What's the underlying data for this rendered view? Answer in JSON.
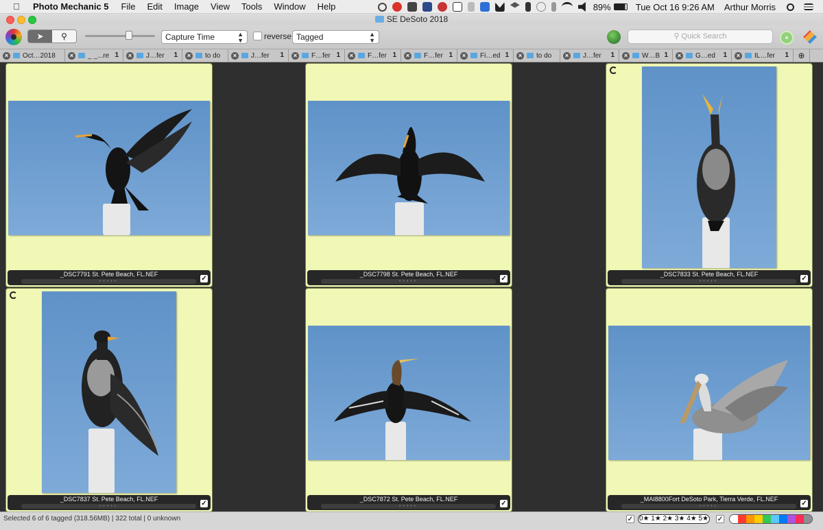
{
  "menubar": {
    "app_name": "Photo Mechanic 5",
    "menus": [
      "File",
      "Edit",
      "Image",
      "View",
      "Tools",
      "Window",
      "Help"
    ],
    "battery": "89%",
    "datetime": "Tue Oct 16  9:26 AM",
    "user": "Arthur Morris"
  },
  "window": {
    "title": "SE DeSoto 2018"
  },
  "toolbar": {
    "sort_select": "Capture Time",
    "reverse_label": "reverse",
    "filter_select": "Tagged",
    "search_placeholder": "Quick Search"
  },
  "tabs": [
    {
      "label": "Oct…2018",
      "count": "",
      "folder": true
    },
    {
      "label": "_ _...re",
      "count": "1",
      "folder": true
    },
    {
      "label": "J…fer",
      "count": "1",
      "folder": true
    },
    {
      "label": "to do",
      "count": "",
      "folder": true
    },
    {
      "label": "J…fer",
      "count": "1",
      "folder": true
    },
    {
      "label": "F…fer",
      "count": "1",
      "folder": true
    },
    {
      "label": "F…fer",
      "count": "1",
      "folder": true
    },
    {
      "label": "F…fer",
      "count": "1",
      "folder": true
    },
    {
      "label": "Fi…ed",
      "count": "1",
      "folder": true
    },
    {
      "label": "to do",
      "count": "",
      "folder": true
    },
    {
      "label": "J…fer",
      "count": "1",
      "folder": true
    },
    {
      "label": "W…B",
      "count": "1",
      "folder": true
    },
    {
      "label": "G…ed",
      "count": "1",
      "folder": true
    },
    {
      "label": "IL…fer",
      "count": "1",
      "folder": true
    }
  ],
  "photos": [
    {
      "filename": "_DSC7791 St. Pete Beach, FL.NEF",
      "subject": "cormorant-wings-raised",
      "orientation": "landscape",
      "tagged": true,
      "rotated": false
    },
    {
      "filename": "_DSC7798 St. Pete Beach, FL.NEF",
      "subject": "cormorant-wings-spread",
      "orientation": "landscape",
      "tagged": true,
      "rotated": false
    },
    {
      "filename": "_DSC7833 St. Pete Beach, FL.NEF",
      "subject": "cormorant-bill-up",
      "orientation": "portrait",
      "tagged": true,
      "rotated": true
    },
    {
      "filename": "_DSC7837 St. Pete Beach, FL.NEF",
      "subject": "cormorant-one-wing",
      "orientation": "portrait",
      "tagged": true,
      "rotated": true
    },
    {
      "filename": "_DSC7872 St. Pete Beach, FL.NEF",
      "subject": "anhinga-wings-spread",
      "orientation": "landscape",
      "tagged": true,
      "rotated": false
    },
    {
      "filename": "_MAI8800Fort DeSoto Park, Tierra Verde, FL.NEF",
      "subject": "brown-pelican-preening",
      "orientation": "landscape",
      "tagged": true,
      "rotated": false
    }
  ],
  "statusbar": {
    "text": "Selected 6 of 6 tagged (318.56MB) | 322 total | 0 unknown",
    "stars": "0★ 1★ 2★ 3★ 4★ 5★"
  },
  "colors": {
    "cell_bg": "#f1f8b6",
    "sheet_bg": "#2f2f2f",
    "sky_blue": "#6f9fd0",
    "label_colors": [
      "#ffffff",
      "#ff3b30",
      "#ff9500",
      "#ffcc00",
      "#34c759",
      "#5ac8fa",
      "#007aff",
      "#af52de",
      "#ff2d55",
      "#8e8e93"
    ]
  }
}
